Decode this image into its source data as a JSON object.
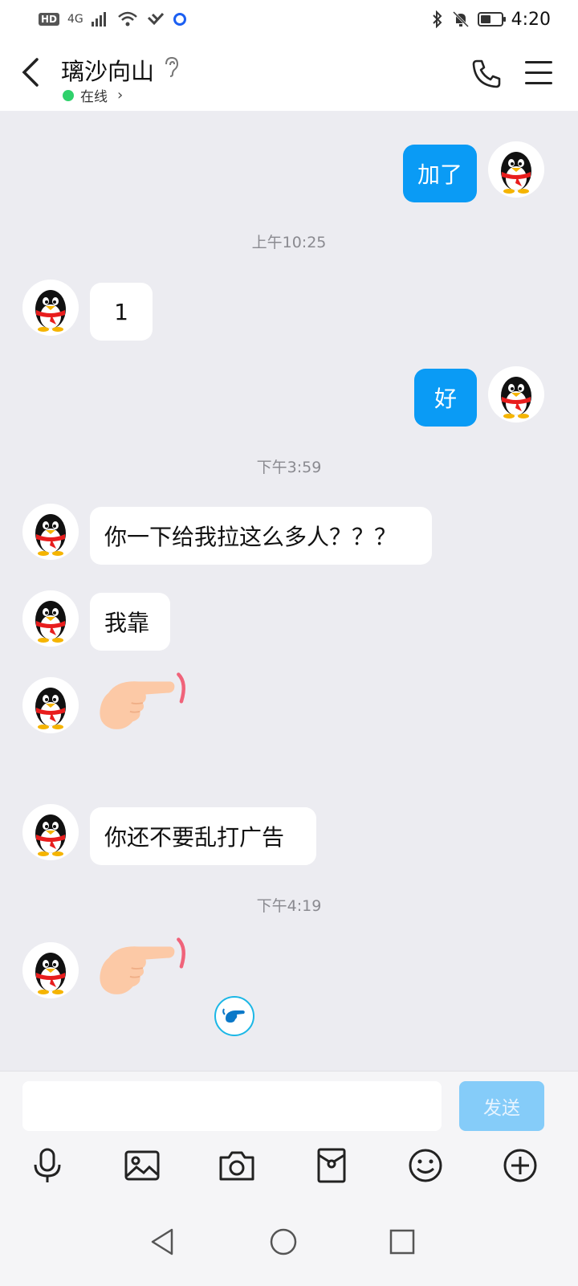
{
  "status_bar": {
    "hd": "HD",
    "network": "4G",
    "time": "4:20"
  },
  "header": {
    "title": "璃沙向山",
    "status": "在线"
  },
  "messages": [
    {
      "dir": "out",
      "text": "加了"
    },
    {
      "type": "time",
      "text": "上午10:25"
    },
    {
      "dir": "in",
      "text": "1"
    },
    {
      "dir": "out",
      "text": "好"
    },
    {
      "type": "time",
      "text": "下午3:59"
    },
    {
      "dir": "in",
      "text": "你一下给我拉这么多人？？？"
    },
    {
      "dir": "in",
      "text": "我靠"
    },
    {
      "dir": "in",
      "emoji": "pointing-hand"
    },
    {
      "dir": "in",
      "text": "你还不要乱打广告"
    },
    {
      "type": "time",
      "text": "下午4:19"
    },
    {
      "dir": "in",
      "emoji": "pointing-hand"
    }
  ],
  "input": {
    "value": "",
    "send_label": "发送"
  },
  "toolbar_icons": [
    "mic-icon",
    "image-icon",
    "camera-icon",
    "red-packet-icon",
    "emoji-icon",
    "plus-icon"
  ],
  "colors": {
    "outgoing_bubble": "#0a9bf5",
    "incoming_bubble": "#ffffff",
    "background": "#ececf1",
    "online_dot": "#2fd16b",
    "send_button": "#85ccf9"
  }
}
